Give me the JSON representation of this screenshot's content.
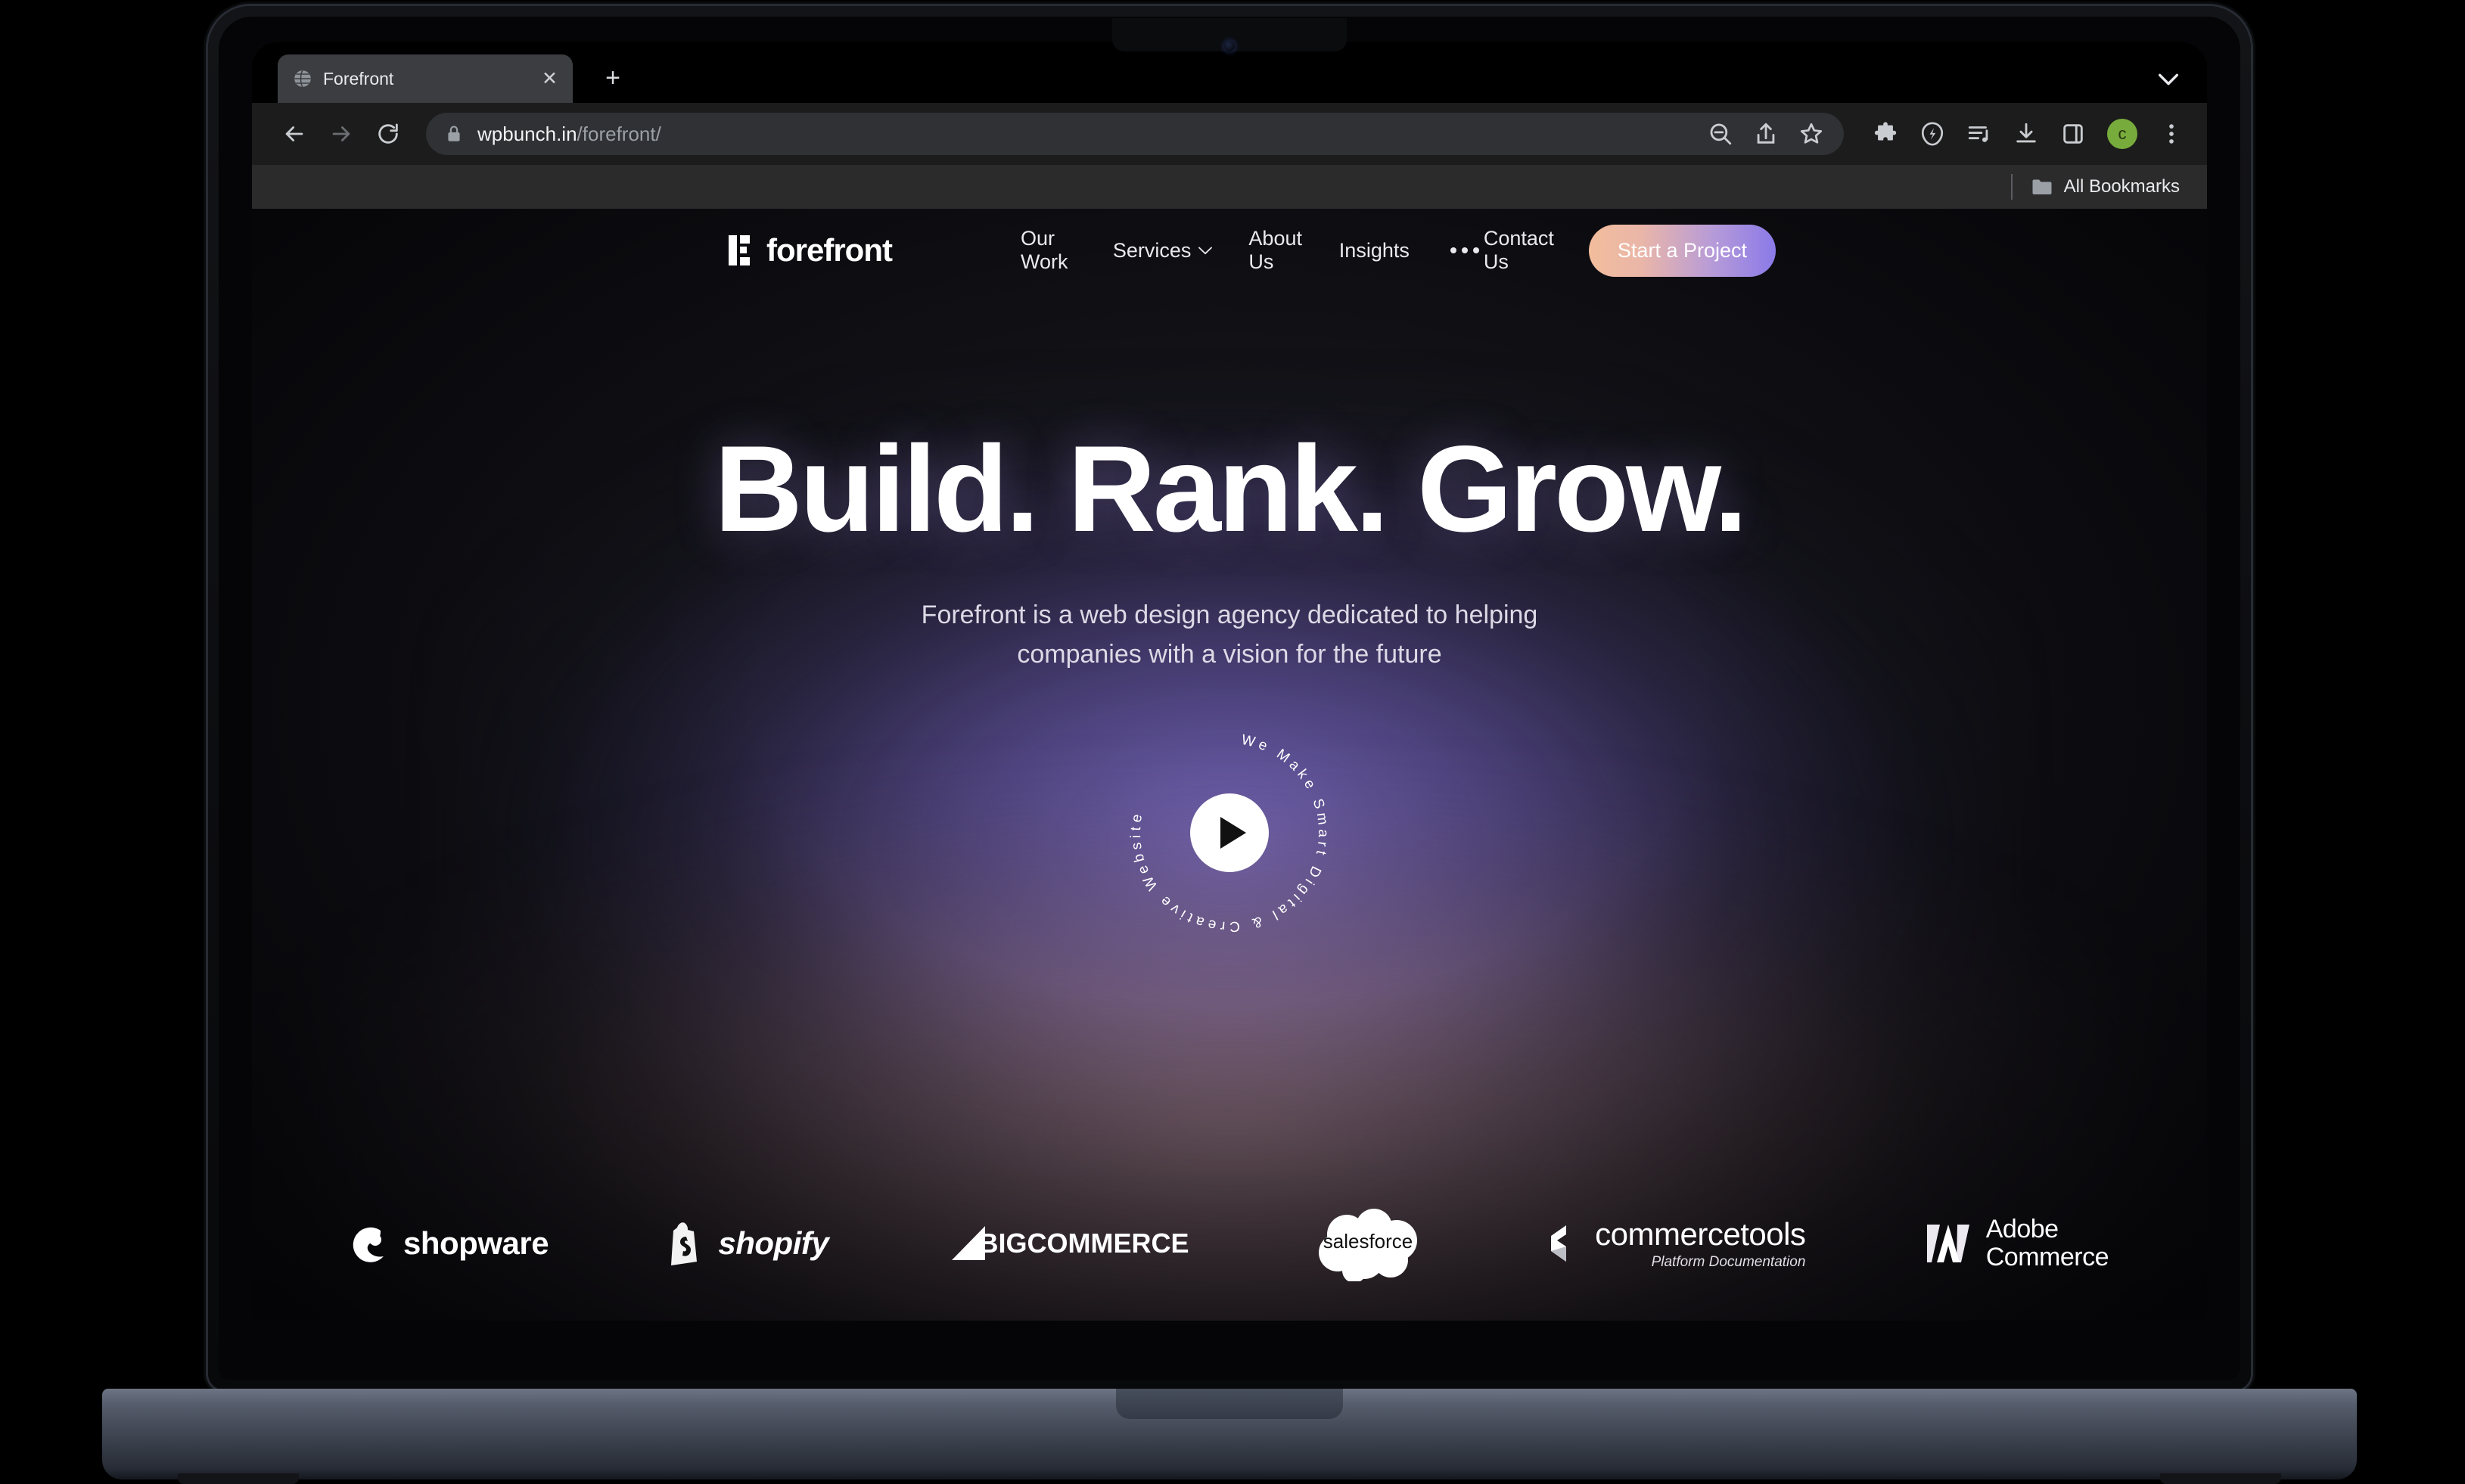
{
  "browser": {
    "tab": {
      "title": "Forefront",
      "favicon_icon": "globe-icon",
      "close_icon": "close-icon"
    },
    "new_tab_icon": "plus-icon",
    "tab_search_icon": "chevron-down-icon",
    "back_icon": "arrow-left-icon",
    "forward_icon": "arrow-right-icon",
    "reload_icon": "reload-icon",
    "address": {
      "lock_icon": "lock-icon",
      "domain": "wpbunch.in",
      "path": "/forefront/"
    },
    "omnibox_icons": [
      "zoom-out-icon",
      "share-icon",
      "bookmark-star-icon"
    ],
    "extension_icons": [
      "puzzle-extensions-icon",
      "energy-saver-leaf-icon",
      "media-playlist-icon",
      "download-icon",
      "side-panel-icon"
    ],
    "avatar_initial": "c",
    "menu_icon": "kebab-menu-icon",
    "bookmarks": {
      "folder_icon": "folder-icon",
      "label": "All Bookmarks"
    }
  },
  "site": {
    "logo": {
      "mark_icon": "forefront-blocks-icon",
      "text": "forefront"
    },
    "nav": [
      {
        "label": "Our Work",
        "has_chevron": false
      },
      {
        "label": "Services",
        "has_chevron": true
      },
      {
        "label": "About Us",
        "has_chevron": false
      },
      {
        "label": "Insights",
        "has_chevron": false
      }
    ],
    "more_icon": "ellipsis-icon",
    "contact_label": "Contact Us",
    "cta_label": "Start a Project",
    "hero": {
      "headline": "Build. Rank. Grow.",
      "sub_line1": "Forefront is a web design agency dedicated to helping",
      "sub_line2": "companies with a vision for the future"
    },
    "play_badge": {
      "circular_text": "We Make Smart Digital & Creative Website",
      "play_icon": "play-icon"
    },
    "brands": [
      {
        "name": "shopware",
        "icon": "shopware-icon",
        "word": "shopware",
        "sub": ""
      },
      {
        "name": "shopify",
        "icon": "shopify-bag-icon",
        "word": "shopify",
        "sub": ""
      },
      {
        "name": "bigcommerce",
        "icon": "bigcommerce-triangle-icon",
        "word": "BIGCOMMERCE",
        "sub": ""
      },
      {
        "name": "salesforce",
        "icon": "salesforce-cloud-icon",
        "word": "salesforce",
        "sub": ""
      },
      {
        "name": "commercetools",
        "icon": "commercetools-icon",
        "word": "commercetools",
        "sub": "Platform Documentation"
      },
      {
        "name": "adobe-commerce",
        "icon": "adobe-a-icon",
        "word": "Adobe Commerce",
        "sub": ""
      }
    ]
  },
  "colors": {
    "cta_gradient_start": "#f2bd9c",
    "cta_gradient_end": "#8a7ae8",
    "cursor": "#7d6ae8",
    "glow_purple": "#7c6cc4",
    "glow_rose": "#ba9292",
    "avatar": "#77ac3c"
  }
}
